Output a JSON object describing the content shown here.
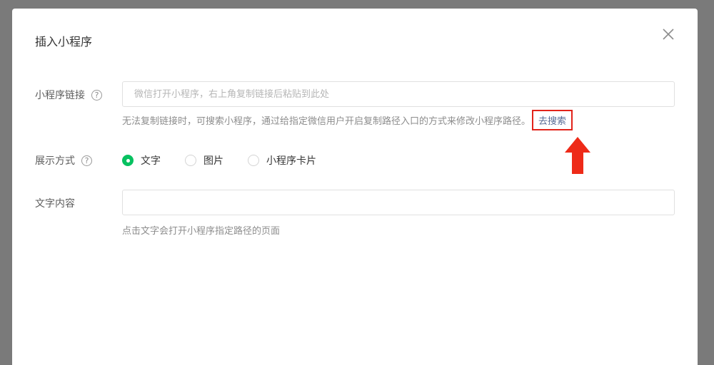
{
  "dialog": {
    "title": "插入小程序"
  },
  "form": {
    "link_field": {
      "label": "小程序链接",
      "help": "?",
      "placeholder": "微信打开小程序，右上角复制链接后粘贴到此处",
      "value": "",
      "hint": "无法复制链接时，可搜索小程序，通过给指定微信用户开启复制路径入口的方式来修改小程序路径。",
      "search_link": "去搜索"
    },
    "display_mode": {
      "label": "展示方式",
      "help": "?",
      "options": [
        {
          "label": "文字",
          "checked": true
        },
        {
          "label": "图片",
          "checked": false
        },
        {
          "label": "小程序卡片",
          "checked": false
        }
      ]
    },
    "text_content": {
      "label": "文字内容",
      "value": "",
      "hint": "点击文字会打开小程序指定路径的页面"
    }
  },
  "colors": {
    "overlay": "#7a7a7a",
    "accent_green": "#07c160",
    "link_blue": "#576b95",
    "annotation_red": "#e2231a"
  }
}
